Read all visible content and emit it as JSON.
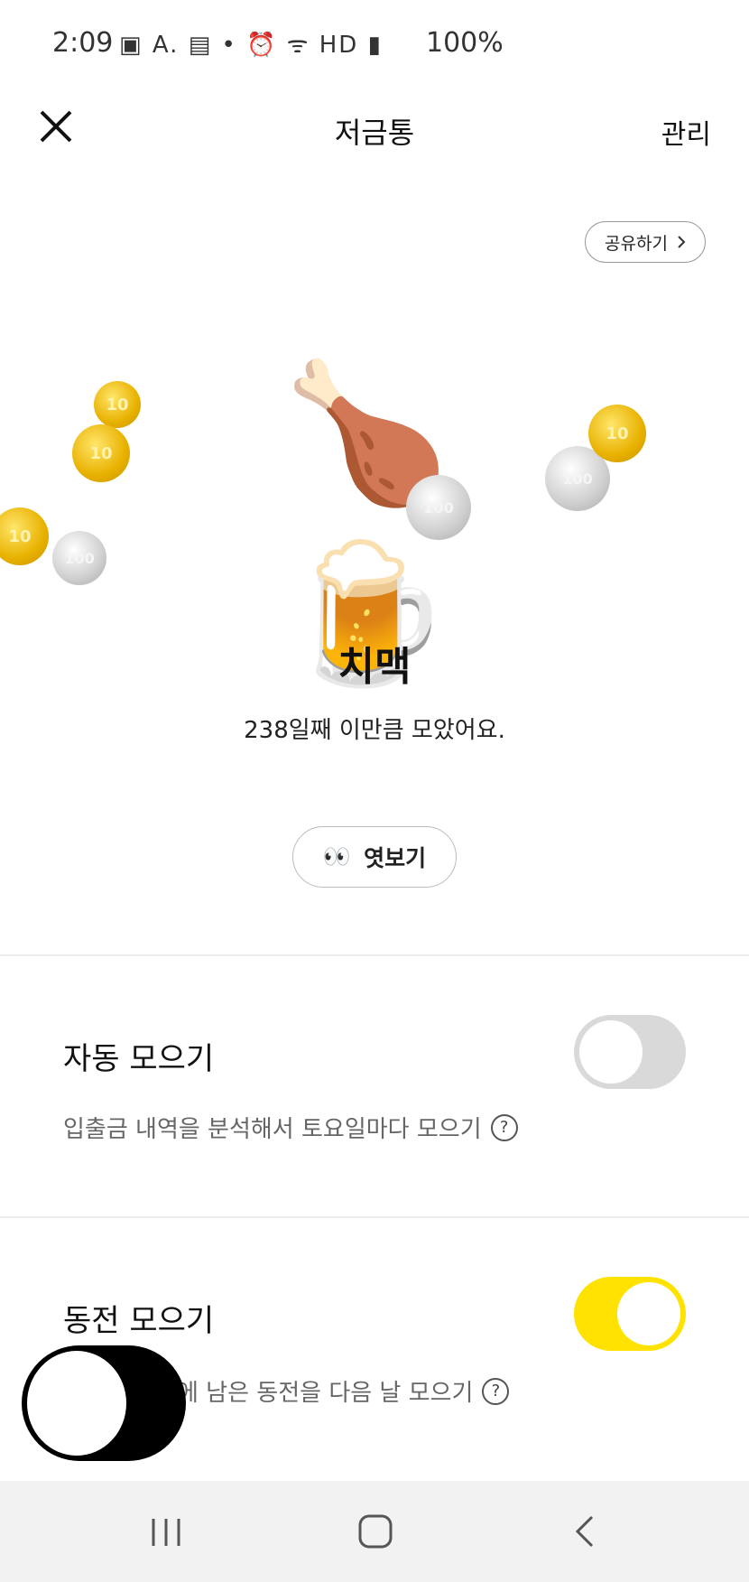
{
  "status_bar": {
    "time": "2:09",
    "battery": "100%"
  },
  "header": {
    "title": "저금통",
    "manage_label": "관리"
  },
  "share_label": "공유하기",
  "illustration": {
    "main_emoji": "🍗🍺",
    "coin_gold_label": "10",
    "coin_silver_label": "100"
  },
  "saving": {
    "name": "치맥",
    "caption": "238일째 이만큼 모았어요.",
    "peek_emoji": "👀",
    "peek_label": "엿보기"
  },
  "auto_save": {
    "title": "자동 모으기",
    "description": "입출금 내역을 분석해서 토요일마다 모으기",
    "help": "?",
    "enabled": false
  },
  "coin_save": {
    "title": "동전 모으기",
    "description": "에 남은 동전을 다음 날 모으기",
    "help": "?",
    "enabled": true
  },
  "colors": {
    "toggle_on": "#ffe200",
    "toggle_off": "#d9d9d9"
  }
}
